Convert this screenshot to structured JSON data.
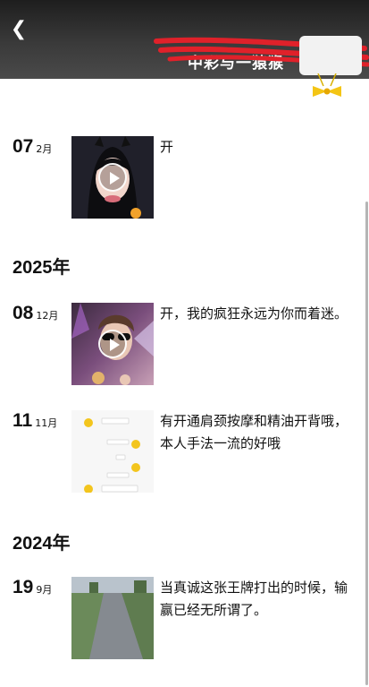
{
  "header": {
    "back_icon": "chevron-left-icon",
    "title": "中彩与一猿猴"
  },
  "feed": {
    "years": [
      "2025年",
      "2024年"
    ],
    "entries": [
      {
        "day": "07",
        "month": "2月",
        "text": "开",
        "media": "video"
      },
      {
        "day": "08",
        "month": "12月",
        "text": "开，我的疯狂永远为你而着迷。",
        "media": "video"
      },
      {
        "day": "11",
        "month": "11月",
        "text": "有开通肩颈按摩和精油开背哦，本人手法一流的好哦",
        "media": "chat-screenshot"
      },
      {
        "day": "19",
        "month": "9月",
        "text": "当真诚这张王牌打出的时候，输赢已经无所谓了。",
        "media": "road-photo"
      }
    ]
  },
  "colors": {
    "header_bg": "#2b2b2b",
    "scribble": "#e0212a",
    "text": "#111111"
  }
}
